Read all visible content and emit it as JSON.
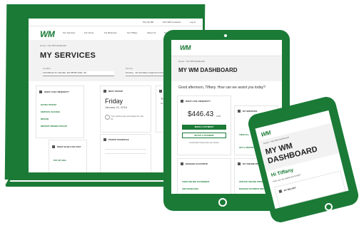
{
  "laptop": {
    "topnav": [
      "Pay My Bill",
      "Find WM Locations",
      "Log In"
    ],
    "logo": "WM",
    "nav": [
      "Our Services",
      "For Home",
      "For Business",
      "Our Tiffany",
      "About Us",
      "Support"
    ],
    "breadcrumb": "Home  >  My WM Dashboard",
    "page_title": "MY SERVICES",
    "location_label": "Location",
    "location_value": "1234 Bristol Dr, Danville, WA 98765-1234, US",
    "service_label": "Service",
    "service_value": "Pending - 96 Gal Sales Organized Curbside/Kerbside",
    "request_title": "WHAT CAN I REQUEST?",
    "request_links": [
      "EXTRA PICKUP",
      "SERVICE CHANGE",
      "REPAIR",
      "REPORT MISSED PICKUP"
    ],
    "else_title": "WHAT ELSE CAN I DO?",
    "pay_link": "PAY MY BILL",
    "next_pickup_label": "NEXT PICKUP",
    "next_pickup_day": "Friday",
    "next_pickup_date": "January 22, 2016",
    "next_pickup_note": "Your pickup was scheduled for Jan 22",
    "schedule_label": "PICKUP SCHEDULE",
    "holiday_label": "HOLIDAY SCH",
    "holiday_text": "Thanksgiving D",
    "holiday_sub": "Delayed Service"
  },
  "tablet": {
    "logo": "WM",
    "breadcrumb": "Home  >  My WM Dashboard",
    "page_title": "MY WM DASHBOARD",
    "greeting": "Good afternoon, Tiffany. How can we assist you today?",
    "pay_title": "WHAT CAN I REQUEST?",
    "amount": "$446.43",
    "amount_currency": "USD",
    "make_payment": "MAKE A PAYMENT",
    "setup_payment": "SETUP A PAYMENT",
    "autopay_note": "Automatic Payments are Active",
    "services_title": "MY SERVICES",
    "view_all": "VIEW ALL",
    "get_report": "GET A REPORT",
    "manage_title": "MANAGE ACCOUNTS",
    "manage_links": [
      "VIEW ONLINE STATEMENT",
      "ADD MANAGER"
    ],
    "profile_title": "MY ONLINE PROFILE",
    "profile_links": [
      "UPDATE ONLINE PROFILE",
      "MANAGE PAYMENT METHOD"
    ]
  },
  "phone": {
    "logo": "WM",
    "breadcrumb": "Home  >  My WM Dashboard",
    "title_line1": "MY WM",
    "title_line2": "DASHBOARD",
    "greeting_name": "Hi Tiffany",
    "greeting_sub": "How can we assist you today?",
    "billing": "MY BILLING"
  },
  "colors": {
    "frame": "#1a7a36",
    "brand_green": "#1a7a36",
    "brand_yellow": "#f4b400",
    "panel_grey": "#f2f2f2"
  }
}
